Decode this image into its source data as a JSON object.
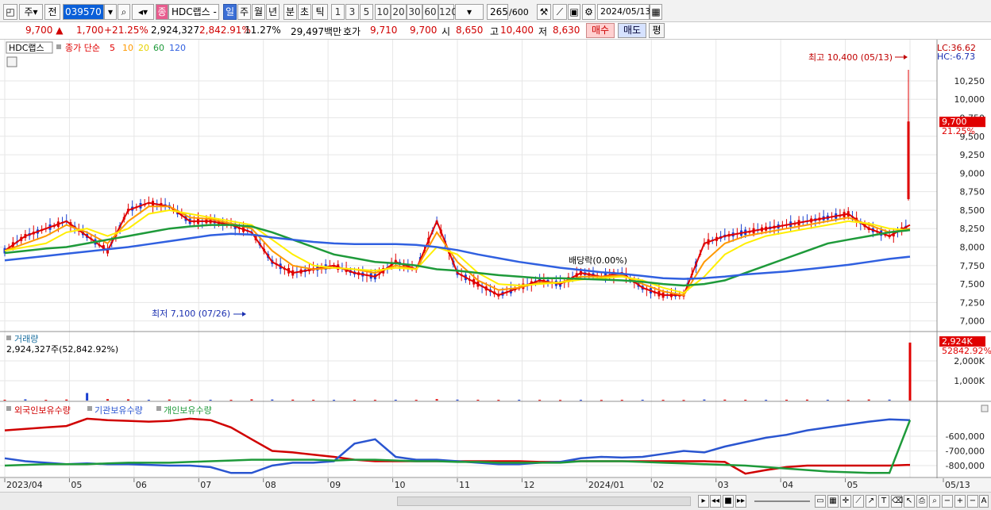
{
  "toolbar": {
    "chart_type": "주",
    "prev_label": "전",
    "code": "039570",
    "stock_name": "HDC랩스 -",
    "period_day": "일",
    "period_week": "주",
    "period_month": "월",
    "period_year": "년",
    "period_min": "분",
    "period_sec": "초",
    "period_tick": "틱",
    "interval_1": "1",
    "interval_3": "3",
    "interval_5": "5",
    "interval_10": "10",
    "interval_20": "20",
    "interval_30": "30",
    "interval_60": "60",
    "interval_120": "120",
    "count": "265",
    "count_total": "/600",
    "date": "2024/05/13"
  },
  "quote": {
    "price": "9,700",
    "change": "1,700",
    "change_pct": "+21.25%",
    "volume": "2,924,327",
    "volume_pct": "2,842.91%",
    "turnover": "11.27%",
    "amount": "29,497백만",
    "ask_label": "호가",
    "ask1": "9,710",
    "ask2": "9,700",
    "open_label": "시",
    "open": "8,650",
    "high_label": "고",
    "high": "10,400",
    "low_label": "저",
    "low": "8,630",
    "buy_label": "매수",
    "sell_label": "매도",
    "eval_label": "평"
  },
  "colors": {
    "ma5": "#e00000",
    "ma10": "#ff9900",
    "ma20": "#ffee00",
    "ma60": "#1e9a3a",
    "ma120": "#3060e0",
    "up": "#e00000",
    "down": "#1a3fd0"
  },
  "chart_data": [
    {
      "type": "line",
      "title": "HDC랩스",
      "legend": {
        "prefix": "종가 단순",
        "periods": [
          "5",
          "10",
          "20",
          "60",
          "120"
        ]
      },
      "x_ticks": [
        "2023/04",
        "05",
        "06",
        "07",
        "08",
        "09",
        "10",
        "11",
        "12",
        "2024/01",
        "02",
        "03",
        "04",
        "05",
        "05/13"
      ],
      "y_ticks": [
        "10,250",
        "10,000",
        "9,750",
        "9,500",
        "9,250",
        "9,000",
        "8,750",
        "8,500",
        "8,250",
        "8,000",
        "7,750",
        "7,500",
        "7,250",
        "7,000"
      ],
      "ylim": [
        6900,
        10550
      ],
      "annotations": {
        "high": "최고 10,400 (05/13)",
        "low": "최저 7,100 (07/26)",
        "dividend": "배당락(0.00%)",
        "lc": "LC:36.62",
        "hc": "HC:-6.73",
        "last_price": "9,700",
        "last_pct": "21.25%"
      },
      "series": [
        {
          "name": "5",
          "values": [
            7950,
            8150,
            8250,
            8350,
            8150,
            7950,
            8500,
            8600,
            8550,
            8350,
            8350,
            8300,
            8200,
            7800,
            7650,
            7700,
            7750,
            7650,
            7600,
            7800,
            7700,
            8350,
            7650,
            7500,
            7350,
            7450,
            7550,
            7500,
            7650,
            7600,
            7650,
            7450,
            7350,
            7350,
            8050,
            8150,
            8200,
            8250,
            8300,
            8350,
            8400,
            8450,
            8250,
            8150,
            8300
          ]
        },
        {
          "name": "10",
          "values": [
            7950,
            8050,
            8150,
            8300,
            8200,
            8050,
            8350,
            8550,
            8550,
            8400,
            8380,
            8320,
            8250,
            7950,
            7750,
            7700,
            7720,
            7700,
            7650,
            7750,
            7700,
            8200,
            7800,
            7550,
            7420,
            7450,
            7520,
            7520,
            7600,
            7600,
            7620,
            7500,
            7400,
            7350,
            7800,
            8050,
            8150,
            8200,
            8250,
            8300,
            8350,
            8400,
            8300,
            8200,
            8250
          ]
        },
        {
          "name": "20",
          "values": [
            7950,
            8000,
            8050,
            8200,
            8250,
            8150,
            8250,
            8450,
            8500,
            8450,
            8400,
            8350,
            8300,
            8100,
            7900,
            7750,
            7720,
            7700,
            7680,
            7720,
            7700,
            8000,
            7900,
            7650,
            7500,
            7480,
            7500,
            7520,
            7560,
            7580,
            7600,
            7550,
            7450,
            7380,
            7600,
            7900,
            8050,
            8150,
            8200,
            8250,
            8300,
            8350,
            8320,
            8250,
            8230
          ]
        },
        {
          "name": "60",
          "values": [
            7920,
            7950,
            7980,
            8000,
            8050,
            8100,
            8150,
            8200,
            8250,
            8280,
            8300,
            8300,
            8280,
            8200,
            8100,
            8000,
            7900,
            7850,
            7800,
            7780,
            7750,
            7700,
            7680,
            7650,
            7620,
            7600,
            7580,
            7580,
            7570,
            7560,
            7550,
            7530,
            7500,
            7480,
            7500,
            7550,
            7650,
            7750,
            7850,
            7950,
            8050,
            8100,
            8150,
            8200,
            8230
          ]
        },
        {
          "name": "120",
          "values": [
            7820,
            7850,
            7880,
            7910,
            7940,
            7970,
            8000,
            8040,
            8080,
            8120,
            8160,
            8180,
            8170,
            8130,
            8100,
            8070,
            8050,
            8040,
            8040,
            8040,
            8030,
            8000,
            7960,
            7900,
            7850,
            7800,
            7760,
            7720,
            7690,
            7660,
            7640,
            7610,
            7580,
            7570,
            7580,
            7600,
            7630,
            7650,
            7670,
            7700,
            7730,
            7760,
            7800,
            7840,
            7870
          ]
        }
      ]
    },
    {
      "type": "bar",
      "title": "거래량",
      "value_label": "2,924,327주(52,842.92%)",
      "y_ticks": [
        "2,000K",
        "1,000K"
      ],
      "ylim": [
        0,
        3000
      ],
      "last_label": "2,924K",
      "last_pct": "52842.92%",
      "values": [
        40,
        60,
        35,
        50,
        380,
        70,
        60,
        40,
        50,
        45,
        40,
        35,
        60,
        50,
        45,
        40,
        35,
        40,
        35,
        40,
        35,
        70,
        45,
        40,
        35,
        40,
        35,
        30,
        35,
        30,
        35,
        40,
        35,
        30,
        50,
        45,
        40,
        35,
        40,
        45,
        40,
        35,
        50,
        45,
        2924
      ]
    },
    {
      "type": "line",
      "series": [
        {
          "name": "외국인보유수량",
          "values": [
            -560000,
            -550000,
            -540000,
            -530000,
            -480000,
            -490000,
            -495000,
            -500000,
            -495000,
            -480000,
            -490000,
            -540000,
            -620000,
            -700000,
            -710000,
            -725000,
            -740000,
            -760000,
            -770000,
            -770000,
            -770000,
            -770000,
            -770000,
            -770000,
            -770000,
            -770000,
            -775000,
            -775000,
            -770000,
            -770000,
            -770000,
            -770000,
            -770000,
            -770000,
            -770000,
            -775000,
            -855000,
            -830000,
            -810000,
            -800000,
            -800000,
            -800000,
            -800000,
            -800000,
            -795000
          ]
        },
        {
          "name": "기관보유수량",
          "values": [
            -750000,
            -770000,
            -780000,
            -790000,
            -785000,
            -790000,
            -790000,
            -795000,
            -800000,
            -800000,
            -810000,
            -850000,
            -850000,
            -800000,
            -780000,
            -780000,
            -770000,
            -650000,
            -620000,
            -740000,
            -760000,
            -760000,
            -770000,
            -780000,
            -790000,
            -790000,
            -780000,
            -775000,
            -750000,
            -740000,
            -745000,
            -740000,
            -720000,
            -700000,
            -710000,
            -670000,
            -640000,
            -610000,
            -590000,
            -560000,
            -540000,
            -520000,
            -500000,
            -485000,
            -490000
          ]
        },
        {
          "name": "개인보유수량",
          "values": [
            -800000,
            -795000,
            -790000,
            -790000,
            -790000,
            -785000,
            -780000,
            -780000,
            -780000,
            -775000,
            -770000,
            -765000,
            -760000,
            -760000,
            -760000,
            -760000,
            -765000,
            -760000,
            -760000,
            -765000,
            -770000,
            -770000,
            -775000,
            -775000,
            -780000,
            -780000,
            -780000,
            -780000,
            -770000,
            -770000,
            -770000,
            -775000,
            -780000,
            -785000,
            -790000,
            -795000,
            -800000,
            -810000,
            -820000,
            -830000,
            -840000,
            -845000,
            -850000,
            -850000,
            -490000
          ]
        }
      ],
      "y_ticks": [
        "-600,000",
        "-700,000",
        "-800,000"
      ],
      "ylim": [
        -870000,
        -470000
      ]
    }
  ]
}
